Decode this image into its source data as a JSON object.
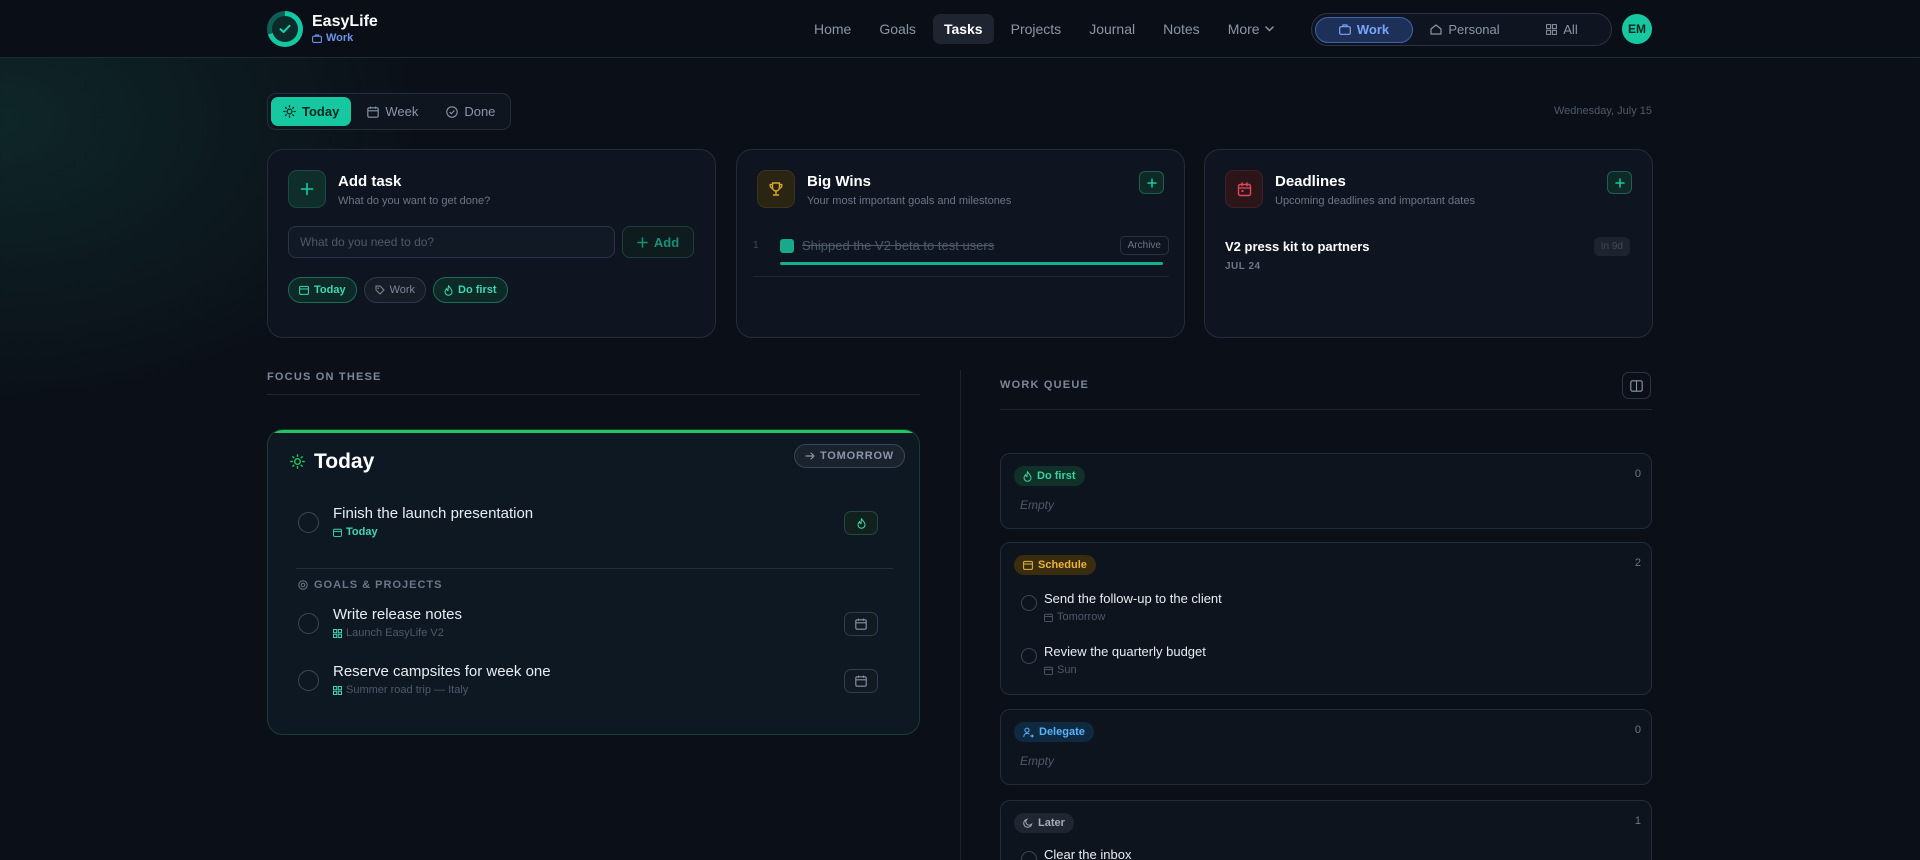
{
  "brand": {
    "name": "EasyLife",
    "context": "Work"
  },
  "nav": {
    "items": [
      "Home",
      "Goals",
      "Tasks",
      "Projects",
      "Journal",
      "Notes"
    ],
    "more": "More",
    "active": "Tasks"
  },
  "context_switch": {
    "items": [
      "Work",
      "Personal",
      "All"
    ],
    "active": "Work"
  },
  "user": {
    "initials": "EM"
  },
  "view_tabs": {
    "items": [
      "Today",
      "Week",
      "Done"
    ],
    "active": "Today"
  },
  "date": "Wednesday, July 15",
  "add_task": {
    "title": "Add task",
    "subtitle": "What do you want to get done?",
    "placeholder": "What do you need to do?",
    "button": "Add",
    "chips": [
      "Today",
      "Work",
      "Do first"
    ]
  },
  "big_wins": {
    "title": "Big Wins",
    "subtitle": "Your most important goals and milestones",
    "items": [
      {
        "number": "1",
        "text": "Shipped the V2 beta to test users",
        "action": "Archive",
        "done": true
      }
    ]
  },
  "deadlines": {
    "title": "Deadlines",
    "subtitle": "Upcoming deadlines and important dates",
    "items": [
      {
        "title": "V2 press kit to partners",
        "date": "JUL 24",
        "badge": "In 9d"
      }
    ]
  },
  "focus": {
    "label": "FOCUS ON THESE",
    "today_title": "Today",
    "tomorrow_button": "TOMORROW",
    "tasks": [
      {
        "title": "Finish the launch presentation",
        "meta": "Today"
      }
    ],
    "goals_label": "GOALS & PROJECTS",
    "goal_tasks": [
      {
        "title": "Write release notes",
        "meta": "Launch EasyLife V2"
      },
      {
        "title": "Reserve campsites for week one",
        "meta": "Summer road trip — Italy"
      }
    ]
  },
  "queue": {
    "label": "WORK QUEUE",
    "groups": [
      {
        "name": "Do first",
        "count": "0",
        "empty": "Empty",
        "tasks": []
      },
      {
        "name": "Schedule",
        "count": "2",
        "tasks": [
          {
            "title": "Send the follow-up to the client",
            "meta": "Tomorrow"
          },
          {
            "title": "Review the quarterly budget",
            "meta": "Sun"
          }
        ]
      },
      {
        "name": "Delegate",
        "count": "0",
        "empty": "Empty",
        "tasks": []
      },
      {
        "name": "Later",
        "count": "1",
        "tasks": [
          {
            "title": "Clear the inbox",
            "meta": ""
          }
        ]
      }
    ]
  },
  "colors": {
    "accent": "#16c8a0",
    "work_blue": "#79a4ff",
    "today_top_line": "#22c55e",
    "trophy": "#e0a82e",
    "deadline_red": "#e0485a",
    "schedule_amber": "#e9b43c",
    "delegate_blue": "#58b4ff"
  },
  "icons": {
    "logo": "check-circle-icon",
    "context": "briefcase-icon",
    "today": "sun-icon",
    "week": "calendar-icon",
    "done": "check-circle-icon",
    "add": "plus-icon",
    "big_wins": "trophy-icon",
    "deadlines": "calendar-icon",
    "do_first": "flame-icon",
    "schedule": "calendar-icon",
    "delegate": "user-arrow-icon",
    "later": "moon-icon",
    "project": "grid-icon",
    "goals": "target-icon",
    "queue_toggle": "columns-icon"
  }
}
